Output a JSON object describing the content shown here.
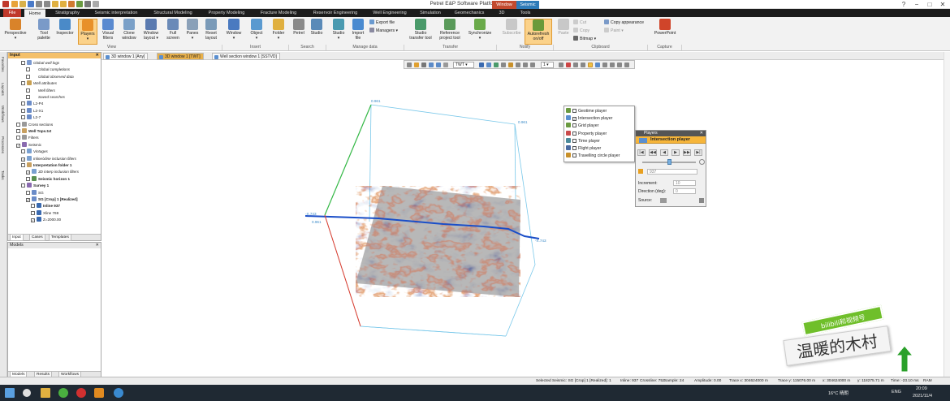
{
  "window": {
    "title": "Petrel E&P Software Platform - [Video]",
    "controls": [
      "?",
      "−",
      "□",
      "✕"
    ]
  },
  "ribbon_tabs": [
    {
      "label": "File"
    },
    {
      "label": "Home"
    },
    {
      "label": "Stratigraphy"
    },
    {
      "label": "Seismic interpretation"
    },
    {
      "label": "Structural Modeling"
    },
    {
      "label": "Property Modeling"
    },
    {
      "label": "Fracture Modeling"
    },
    {
      "label": "Reservoir Engineering"
    },
    {
      "label": "Well Engineering"
    },
    {
      "label": "Simulation"
    },
    {
      "label": "Geomechanics"
    },
    {
      "label": "3D"
    },
    {
      "label": "Tools"
    },
    {
      "label": "Window"
    },
    {
      "label": "Seismic"
    }
  ],
  "ribbon": {
    "buttons": [
      {
        "label": "Perspective",
        "sub": "▾"
      },
      {
        "label": "Tool",
        "sub": "palette"
      },
      {
        "label": "Inspector",
        "sub": ""
      },
      {
        "label": "Players",
        "sub": "▾"
      },
      {
        "label": "Visual",
        "sub": "filters"
      },
      {
        "label": "Clone",
        "sub": "window"
      },
      {
        "label": "Window",
        "sub": "layout ▾"
      },
      {
        "label": "Full",
        "sub": "screen"
      },
      {
        "label": "Panes",
        "sub": "▾"
      },
      {
        "label": "Reset",
        "sub": "layout"
      },
      {
        "label": "Window",
        "sub": "▾"
      },
      {
        "label": "Object",
        "sub": "▾"
      },
      {
        "label": "Folder",
        "sub": "▾"
      },
      {
        "label": "Petrel",
        "sub": ""
      },
      {
        "label": "Studio",
        "sub": ""
      },
      {
        "label": "Studio",
        "sub": "▾"
      },
      {
        "label": "Import",
        "sub": "file"
      },
      {
        "label": "Studio",
        "sub": "transfer tool"
      },
      {
        "label": "Reference",
        "sub": "project tool"
      },
      {
        "label": "Synchronize",
        "sub": "▾"
      },
      {
        "label": "Subscribe",
        "sub": ""
      },
      {
        "label": "Autorefresh",
        "sub": "on/off"
      },
      {
        "label": "Paste",
        "sub": ""
      },
      {
        "label": "PowerPoint",
        "sub": ""
      }
    ],
    "small": {
      "export_file": "Export file",
      "managers": "Managers ▾",
      "cut": "Cut",
      "copy": "Copy",
      "bitmap": "Bitmap ▾",
      "copy_appearance": "Copy appearance",
      "paint": "Paint ▾"
    },
    "groups": [
      "View",
      "Insert",
      "Search",
      "Manage data",
      "Transfer",
      "Notify",
      "Clipboard",
      "Capture"
    ]
  },
  "side_tabs": [
    "Favorites",
    "Layouts",
    "Workflows",
    "Processes",
    "Tasks"
  ],
  "input_panel": {
    "title": "Input",
    "tree": [
      {
        "label": "Global well logs",
        "style": "it",
        "checked": "",
        "icon": "#7b9ad0",
        "indent": 1
      },
      {
        "label": "Global completions",
        "style": "it",
        "checked": "",
        "icon": "",
        "indent": 2
      },
      {
        "label": "Global observed data",
        "style": "it",
        "checked": "",
        "icon": "",
        "indent": 2
      },
      {
        "label": "Well attributes",
        "style": "it",
        "checked": "",
        "icon": "#c9a050",
        "indent": 1
      },
      {
        "label": "Well filters",
        "style": "it",
        "checked": "",
        "icon": "",
        "indent": 2
      },
      {
        "label": "Saved searches",
        "style": "it",
        "checked": "",
        "icon": "",
        "indent": 2
      },
      {
        "label": "L2-P4",
        "style": "",
        "checked": "",
        "icon": "#6b8cc8",
        "indent": 1
      },
      {
        "label": "L2-X1",
        "style": "",
        "checked": "",
        "icon": "#6b8cc8",
        "indent": 1
      },
      {
        "label": "L2-7",
        "style": "",
        "checked": "",
        "icon": "#6b8cc8",
        "indent": 1
      },
      {
        "label": "Cross sections",
        "style": "",
        "checked": "",
        "icon": "#999",
        "indent": 0
      },
      {
        "label": "Well Tops.txt",
        "style": "b",
        "checked": "",
        "icon": "#c8a060",
        "indent": 0
      },
      {
        "label": "Filters",
        "style": "",
        "checked": "",
        "icon": "#999",
        "indent": 0
      },
      {
        "label": "Seismic",
        "style": "",
        "checked": "✓",
        "icon": "#8a6bb0",
        "indent": 0
      },
      {
        "label": "Vintages",
        "style": "it",
        "checked": "",
        "icon": "#7aa0d0",
        "indent": 1
      },
      {
        "label": "Inline/xline inclusion filters",
        "style": "it",
        "checked": "✓",
        "icon": "#7aa0d0",
        "indent": 1
      },
      {
        "label": "Interpretation folder 1",
        "style": "b",
        "checked": "",
        "icon": "#c8a060",
        "indent": 1
      },
      {
        "label": "3D interp inclusion filters",
        "style": "it",
        "checked": "✓",
        "icon": "#7aa0d0",
        "indent": 2
      },
      {
        "label": "Seismic horizon 1",
        "style": "b",
        "checked": "",
        "icon": "#5a9050",
        "indent": 2
      },
      {
        "label": "Survey 1",
        "style": "b",
        "checked": "",
        "icon": "#8a6bb0",
        "indent": 1
      },
      {
        "label": "SG",
        "style": "",
        "checked": "",
        "icon": "#6b8cc8",
        "indent": 2
      },
      {
        "label": "SG [Crop] 1 [Realized]",
        "style": "b",
        "checked": "✓",
        "icon": "#6b8cc8",
        "indent": 2
      },
      {
        "label": "Inline 937",
        "style": "b",
        "checked": "",
        "icon": "#3a6ab0",
        "indent": 3
      },
      {
        "label": "Xline 769",
        "style": "",
        "checked": "",
        "icon": "#3a6ab0",
        "indent": 3
      },
      {
        "label": "Z=2000.00",
        "style": "",
        "checked": "✓",
        "icon": "#3a6ab0",
        "indent": 3
      }
    ],
    "tabs": [
      "Input",
      "Cases",
      "Templates"
    ]
  },
  "models_panel": {
    "title": "Models",
    "tabs": [
      "Models",
      "Results",
      "Workflows"
    ]
  },
  "window_tabs": [
    {
      "label": "3D window 1 [Any]",
      "active": false
    },
    {
      "label": "3D window 1 [TWT]",
      "active": true
    },
    {
      "label": "Well section window 1 [SSTVD]",
      "active": false
    }
  ],
  "view_toolbar": {
    "domain": "TWT",
    "zoom": "1"
  },
  "scene": {
    "labels": [
      "0.961",
      "0.961",
      "-X.743",
      "0.961",
      "-X.743"
    ],
    "colors": {
      "vertical": "#33b845",
      "x_axis": "#e03a2a",
      "line": "#1a4ec8",
      "box": "#7ac8ea"
    }
  },
  "player_list": {
    "items": [
      {
        "label": "Geotime player",
        "checked": "",
        "icon": "#6a9a40"
      },
      {
        "label": "Intersection player",
        "checked": "✓",
        "icon": "#5a8fd0"
      },
      {
        "label": "Grid player",
        "checked": "",
        "icon": "#6a9a40"
      },
      {
        "label": "Property player",
        "checked": "",
        "icon": "#c94a4a"
      },
      {
        "label": "Time player",
        "checked": "",
        "icon": "#4a8a9a"
      },
      {
        "label": "Flight player",
        "checked": "",
        "icon": "#4a6aa0"
      },
      {
        "label": "Travelling circle player",
        "checked": "",
        "icon": "#c8902a"
      }
    ]
  },
  "player_panel": {
    "title": "Players",
    "player": "Intersection player",
    "transport": [
      "|◀",
      "◀◀",
      "◀",
      "▶",
      "▶▶",
      "▶|"
    ],
    "slider_value": 0.5,
    "frame_value": "937",
    "increment_label": "Increment:",
    "increment_value": "10",
    "direction_label": "Direction (deg):",
    "direction_value": "0",
    "source_label": "Source:"
  },
  "status_bar": {
    "selected": "Selected Seismic: SG [Crop] 1 [Realized]: 1",
    "inline": "Inline: 937",
    "crossline": "Crossline: 752",
    "sample": "Sample: 24",
    "amplitude": "Amplitude: 0.00",
    "trace_x": "Trace x: 304624000 m",
    "trace_y": "Trace y: 115076.00 m",
    "x": "x: 304624000 m",
    "y": "y: 118275.71 m",
    "time": "Time: -23.10 ms",
    "ram": "RAM"
  },
  "taskbar": {
    "weather": "16°C 晴朗",
    "lang": "ENG",
    "time": "20:09",
    "date": "2021/11/4"
  },
  "watermark": {
    "line1": "bilibili和视频号",
    "line2": "温暖的木村"
  }
}
